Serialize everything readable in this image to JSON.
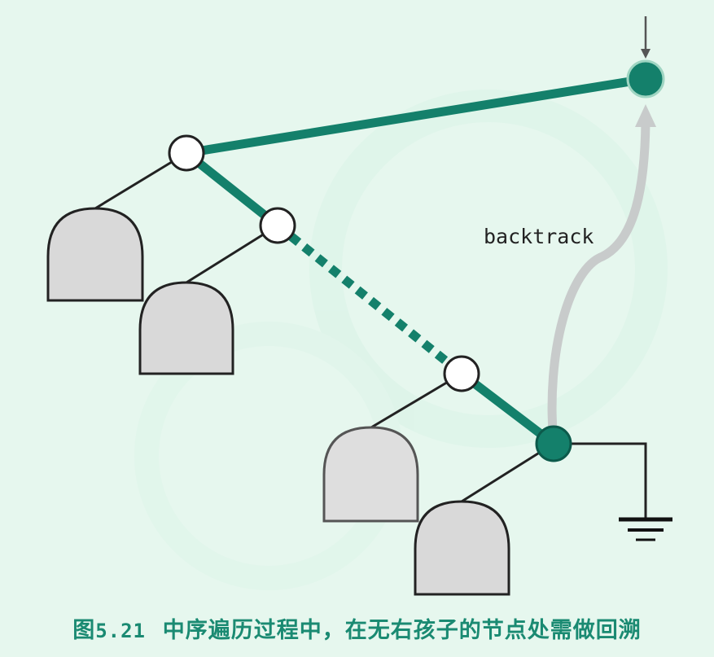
{
  "diagram": {
    "annotation": "backtrack",
    "caption_prefix": "图",
    "caption_number": "5.21",
    "caption_text": "中序遍历过程中，在无右孩子的节点处需做回溯"
  },
  "colors": {
    "background": "#e6f7ee",
    "path_green": "#14806b",
    "node_fill": "#ffffff",
    "subtree_fill": "#d9d9d9",
    "backtrack_arrow": "#c8cbcb",
    "caption": "#1a8a72"
  }
}
